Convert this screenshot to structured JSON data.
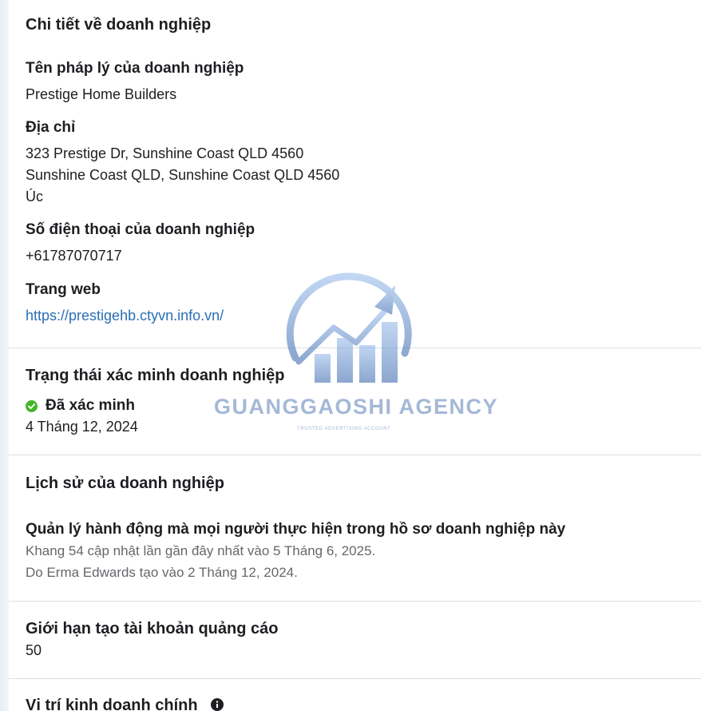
{
  "business_details": {
    "title": "Chi tiết về doanh nghiệp",
    "legal_name_label": "Tên pháp lý của doanh nghiệp",
    "legal_name_value": "Prestige Home Builders",
    "address_label": "Địa chỉ",
    "address_line1": "323 Prestige Dr, Sunshine Coast QLD 4560",
    "address_line2": "Sunshine Coast QLD, Sunshine Coast QLD 4560",
    "address_line3": "Úc",
    "phone_label": "Số điện thoại của doanh nghiệp",
    "phone_value": "+61787070717",
    "website_label": "Trang web",
    "website_value": "https://prestigehb.ctyvn.info.vn/"
  },
  "verification": {
    "title": "Trạng thái xác minh doanh nghiệp",
    "status": "Đã xác minh",
    "date": "4 Tháng 12, 2024",
    "status_color": "#42b72a"
  },
  "history": {
    "title": "Lịch sử của doanh nghiệp",
    "manage_label": "Quản lý hành động mà mọi người thực hiện trong hồ sơ doanh nghiệp này",
    "last_updated": "Khang 54 cập nhật lần gần đây nhất vào 5 Tháng 6, 2025.",
    "created_by": "Do Erma Edwards tạo vào 2 Tháng 12, 2024."
  },
  "ad_account_limit": {
    "title": "Giới hạn tạo tài khoản quảng cáo",
    "value": "50"
  },
  "primary_location": {
    "title": "Vị trí kinh doanh chính",
    "icon": "info-icon"
  },
  "watermark": {
    "name": "GUANGGAOSHI AGENCY",
    "tagline": "TRUSTED ADVERTISING ACCOUNT"
  }
}
